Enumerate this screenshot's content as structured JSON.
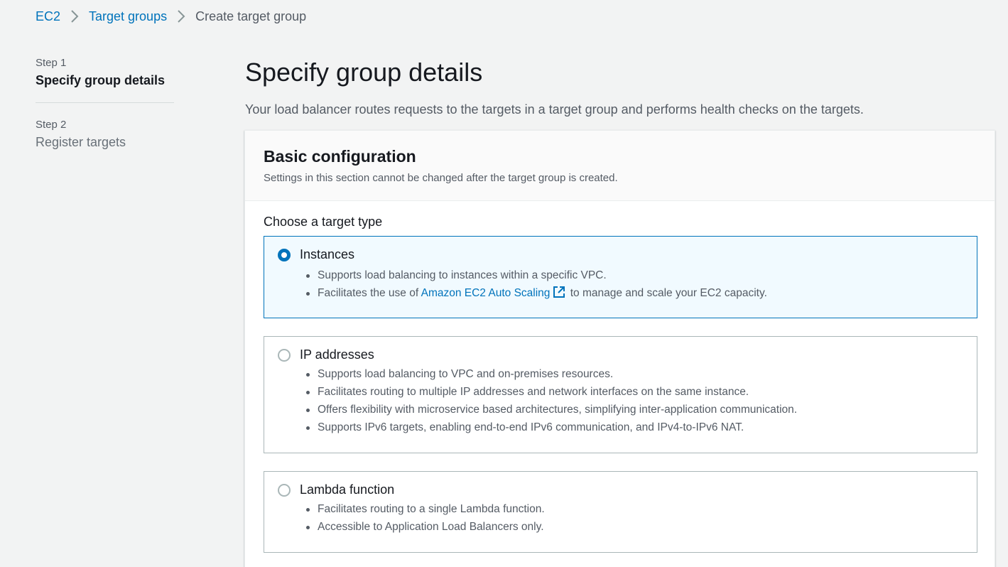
{
  "breadcrumb": {
    "items": [
      {
        "label": "EC2"
      },
      {
        "label": "Target groups"
      },
      {
        "label": "Create target group"
      }
    ]
  },
  "steps": [
    {
      "step": "Step 1",
      "title": "Specify group details",
      "active": true
    },
    {
      "step": "Step 2",
      "title": "Register targets",
      "active": false
    }
  ],
  "main": {
    "title": "Specify group details",
    "description": "Your load balancer routes requests to the targets in a target group and performs health checks on the targets."
  },
  "panel": {
    "title": "Basic configuration",
    "description": "Settings in this section cannot be changed after the target group is created."
  },
  "target_type": {
    "label": "Choose a target type",
    "selected": "Instances",
    "options": [
      {
        "title": "Instances",
        "bullets": [
          "Supports load balancing to instances within a specific VPC.",
          {
            "before": "Facilitates the use of ",
            "link": "Amazon EC2 Auto Scaling",
            "after": " to manage and scale your EC2 capacity."
          }
        ]
      },
      {
        "title": "IP addresses",
        "bullets": [
          "Supports load balancing to VPC and on-premises resources.",
          "Facilitates routing to multiple IP addresses and network interfaces on the same instance.",
          "Offers flexibility with microservice based architectures, simplifying inter-application communication.",
          "Supports IPv6 targets, enabling end-to-end IPv6 communication, and IPv4-to-IPv6 NAT."
        ]
      },
      {
        "title": "Lambda function",
        "bullets": [
          "Facilitates routing to a single Lambda function.",
          "Accessible to Application Load Balancers only."
        ]
      }
    ]
  },
  "colors": {
    "link": "#0073bb",
    "selected_border": "#0073bb",
    "selected_bg": "#f1faff",
    "page_bg": "#f2f3f3"
  },
  "icons": [
    "chevron-right-icon",
    "external-link-icon",
    "radio-selected-icon",
    "radio-unselected-icon"
  ]
}
